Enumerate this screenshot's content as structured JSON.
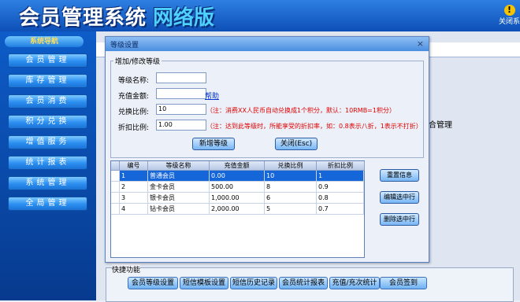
{
  "header": {
    "title": "会员管理系统",
    "version": "网络版",
    "close_label": "关闭系"
  },
  "sidebar": {
    "title": "系统导航",
    "items": [
      "会员管理",
      "库存管理",
      "会员消费",
      "积分兑换",
      "增值服务",
      "统计报表",
      "系统管理",
      "全局管理"
    ]
  },
  "background": {
    "right_label": "综合管理",
    "bottom_group_label": "快捷功能",
    "quick_buttons": [
      "会员等级设置",
      "短信模板设置",
      "短信历史记录",
      "会员统计报表",
      "充值/充次统计",
      "会员签到"
    ]
  },
  "dialog": {
    "title": "等级设置",
    "close_symbol": "×",
    "group_label": "增加/修改等级",
    "fields": {
      "name_label": "等级名称:",
      "name_value": "",
      "recharge_label": "充值金额:",
      "recharge_value": "",
      "help_link": "帮助",
      "ratio_label": "兑换比例:",
      "ratio_value": "10",
      "ratio_note": "（注：消费XX人民币自动兑换成1个积分，默认：10RMB=1积分）",
      "discount_label": "折扣比例:",
      "discount_value": "1.00",
      "discount_note": "（注：达到此等级时，所能享受的折扣率，如：0.8表示八折，1表示不打折）"
    },
    "buttons": {
      "add": "新增等级",
      "close": "关闭(Esc)",
      "reset": "重置信息",
      "edit": "编辑选中行",
      "delete": "删除选中行"
    },
    "table": {
      "columns": [
        "编号",
        "等级名称",
        "充值金额",
        "兑换比例",
        "折扣比例"
      ],
      "rows": [
        [
          "1",
          "普通会员",
          "0.00",
          "10",
          "1"
        ],
        [
          "2",
          "金卡会员",
          "500.00",
          "8",
          "0.9"
        ],
        [
          "3",
          "银卡会员",
          "1,000.00",
          "6",
          "0.8"
        ],
        [
          "4",
          "钻卡会员",
          "2,000.00",
          "5",
          "0.7"
        ]
      ],
      "selected_row": 0
    }
  }
}
